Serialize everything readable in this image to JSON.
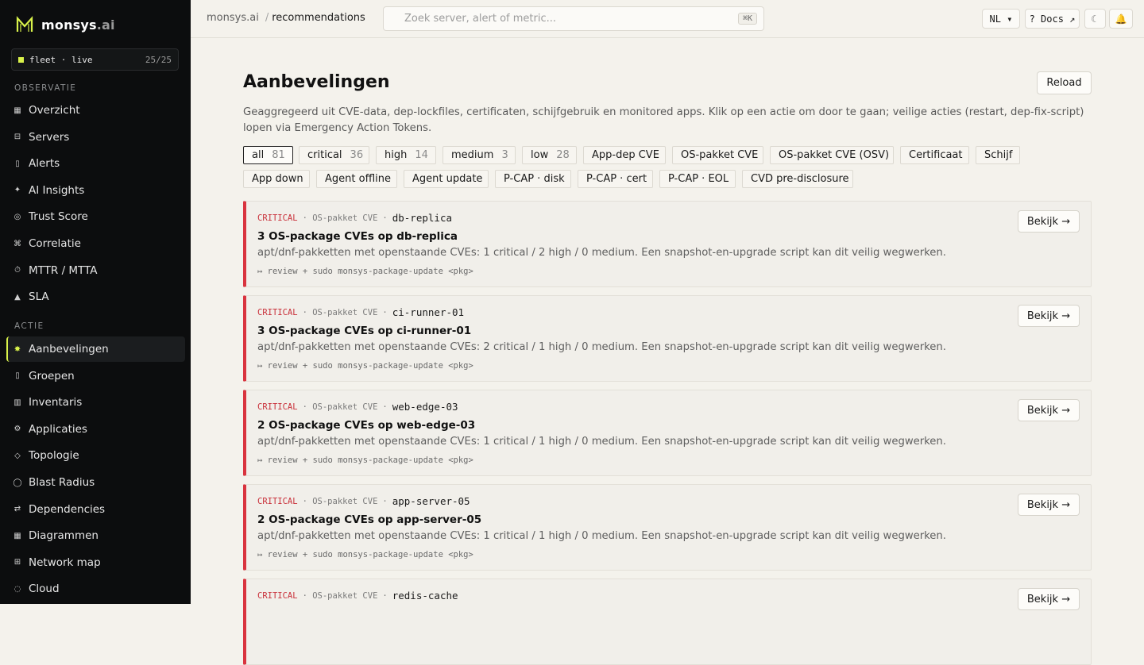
{
  "brand": {
    "name": "monsys",
    "suffix": ".ai"
  },
  "fleet": {
    "label": "fleet · live",
    "count": "25/25"
  },
  "sidebar": {
    "observatie_label": "OBSERVATIE",
    "observatie": [
      {
        "icon": "▦",
        "label": "Overzicht"
      },
      {
        "icon": "⊟",
        "label": "Servers"
      },
      {
        "icon": "▯",
        "label": "Alerts"
      },
      {
        "icon": "✦",
        "label": "AI Insights"
      },
      {
        "icon": "◎",
        "label": "Trust Score"
      },
      {
        "icon": "⌘",
        "label": "Correlatie"
      },
      {
        "icon": "⏱",
        "label": "MTTR / MTTA"
      },
      {
        "icon": "▲",
        "label": "SLA"
      }
    ],
    "actie_label": "ACTIE",
    "actie": [
      {
        "icon": "✸",
        "label": "Aanbevelingen"
      },
      {
        "icon": "▯",
        "label": "Groepen"
      },
      {
        "icon": "▥",
        "label": "Inventaris"
      },
      {
        "icon": "⚙",
        "label": "Applicaties"
      },
      {
        "icon": "◇",
        "label": "Topologie"
      },
      {
        "icon": "◯",
        "label": "Blast Radius"
      },
      {
        "icon": "⇄",
        "label": "Dependencies"
      },
      {
        "icon": "▦",
        "label": "Diagrammen"
      },
      {
        "icon": "⊞",
        "label": "Network map"
      },
      {
        "icon": "◌",
        "label": "Cloud"
      }
    ]
  },
  "topbar": {
    "crumb_root": "monsys.ai",
    "crumb_sep": "/",
    "crumb_current": "recommendations",
    "search_placeholder": "Zoek server, alert of metric...",
    "search_shortcut": "⌘K",
    "lang": "NL ▾",
    "docs": "? Docs ↗",
    "theme_icon": "☾",
    "bell_icon": "🔔"
  },
  "main": {
    "title": "Aanbevelingen",
    "reload": "Reload",
    "description": "Geaggregeerd uit CVE-data, dep-lockfiles, certificaten, schijfgebruik en monitored apps. Klik op een actie om door te gaan; veilige acties (restart, dep-fix-script) lopen via Emergency Action Tokens.",
    "filters_row1": [
      {
        "label": "all",
        "count": "81",
        "active": true
      },
      {
        "label": "critical",
        "count": "36"
      },
      {
        "label": "high",
        "count": "14"
      },
      {
        "label": "medium",
        "count": "3"
      },
      {
        "label": "low",
        "count": "28"
      },
      {
        "label": "App-dep CVE",
        "count": ""
      },
      {
        "label": "OS-pakket CVE",
        "count": ""
      },
      {
        "label": "OS-pakket CVE (OSV)",
        "count": ""
      },
      {
        "label": "Certificaat",
        "count": ""
      },
      {
        "label": "Schijf",
        "count": ""
      }
    ],
    "filters_row2": [
      {
        "label": "App down"
      },
      {
        "label": "Agent offline"
      },
      {
        "label": "Agent update"
      },
      {
        "label": "P-CAP · disk"
      },
      {
        "label": "P-CAP · cert"
      },
      {
        "label": "P-CAP · EOL"
      },
      {
        "label": "CVD pre-disclosure"
      }
    ],
    "cards": [
      {
        "severity": "CRITICAL",
        "category": "· OS-pakket CVE",
        "sep": "·",
        "host": "db-replica",
        "title": "3 OS-package CVEs op db-replica",
        "desc": "apt/dnf-pakketten met openstaande CVEs: 1 critical / 2 high / 0 medium. Een snapshot-en-upgrade script kan dit veilig wegwerken.",
        "cmd": "↦ review + sudo monsys-package-update <pkg>",
        "button": "Bekijk →"
      },
      {
        "severity": "CRITICAL",
        "category": "· OS-pakket CVE",
        "sep": "·",
        "host": "ci-runner-01",
        "title": "3 OS-package CVEs op ci-runner-01",
        "desc": "apt/dnf-pakketten met openstaande CVEs: 2 critical / 1 high / 0 medium. Een snapshot-en-upgrade script kan dit veilig wegwerken.",
        "cmd": "↦ review + sudo monsys-package-update <pkg>",
        "button": "Bekijk →"
      },
      {
        "severity": "CRITICAL",
        "category": "· OS-pakket CVE",
        "sep": "·",
        "host": "web-edge-03",
        "title": "2 OS-package CVEs op web-edge-03",
        "desc": "apt/dnf-pakketten met openstaande CVEs: 1 critical / 1 high / 0 medium. Een snapshot-en-upgrade script kan dit veilig wegwerken.",
        "cmd": "↦ review + sudo monsys-package-update <pkg>",
        "button": "Bekijk →"
      },
      {
        "severity": "CRITICAL",
        "category": "· OS-pakket CVE",
        "sep": "·",
        "host": "app-server-05",
        "title": "2 OS-package CVEs op app-server-05",
        "desc": "apt/dnf-pakketten met openstaande CVEs: 1 critical / 1 high / 0 medium. Een snapshot-en-upgrade script kan dit veilig wegwerken.",
        "cmd": "↦ review + sudo monsys-package-update <pkg>",
        "button": "Bekijk →"
      },
      {
        "severity": "CRITICAL",
        "category": "· OS-pakket CVE",
        "sep": "·",
        "host": "redis-cache",
        "title": "",
        "desc": "",
        "cmd": "",
        "button": "Bekijk →"
      }
    ]
  },
  "colors": {
    "accent": "#d9f24a",
    "critical": "#d9343f",
    "sidebar_bg": "#0c0d0e",
    "page_bg": "#f4f2ec"
  }
}
